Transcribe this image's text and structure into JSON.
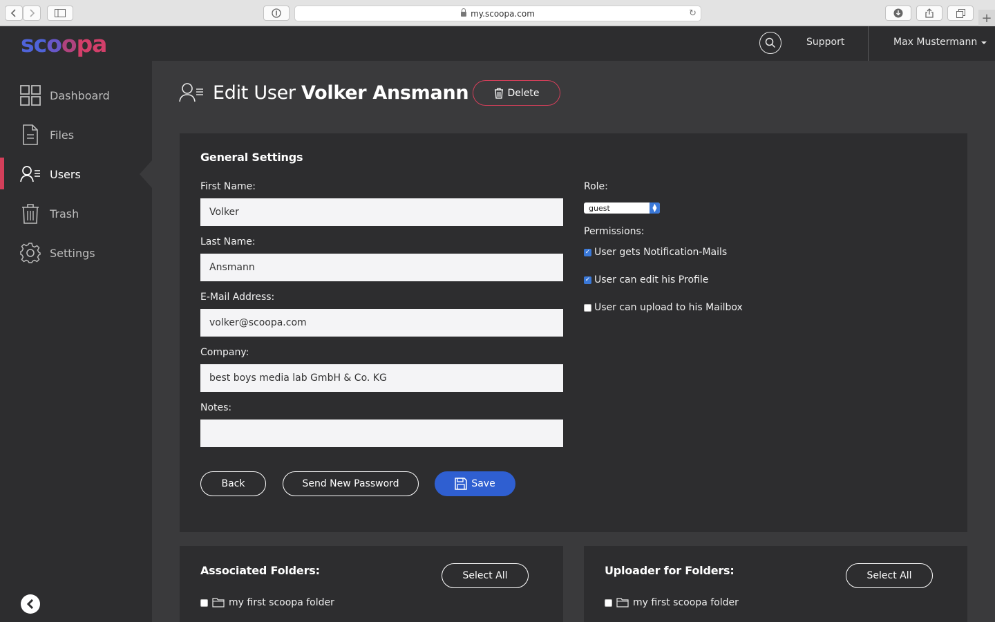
{
  "browser": {
    "url": "my.scoopa.com"
  },
  "brand": {
    "logo_text": "scoopa",
    "accent_red": "#d33f5a",
    "accent_blue": "#2f5fd1"
  },
  "topbar": {
    "support_label": "Support",
    "user_name": "Max Mustermann"
  },
  "sidebar": {
    "items": [
      {
        "label": "Dashboard",
        "icon": "dashboard-icon"
      },
      {
        "label": "Files",
        "icon": "file-icon"
      },
      {
        "label": "Users",
        "icon": "users-icon",
        "active": true
      },
      {
        "label": "Trash",
        "icon": "trash-icon"
      },
      {
        "label": "Settings",
        "icon": "gear-icon"
      }
    ]
  },
  "page": {
    "title_prefix": "Edit User",
    "title_name": "Volker Ansmann",
    "delete_label": "Delete"
  },
  "general": {
    "title": "General Settings",
    "first_name_label": "First Name:",
    "first_name": "Volker",
    "last_name_label": "Last Name:",
    "last_name": "Ansmann",
    "email_label": "E-Mail Address:",
    "email": "volker@scoopa.com",
    "company_label": "Company:",
    "company": "best boys media lab GmbH & Co. KG",
    "notes_label": "Notes:",
    "notes": "",
    "role_label": "Role:",
    "role_value": "guest",
    "permissions_label": "Permissions:",
    "permissions": [
      {
        "label": "User gets Notification-Mails",
        "checked": true
      },
      {
        "label": "User can edit his Profile",
        "checked": true
      },
      {
        "label": "User can upload to his Mailbox",
        "checked": false
      }
    ],
    "back_label": "Back",
    "send_password_label": "Send New Password",
    "save_label": "Save"
  },
  "associated": {
    "title": "Associated Folders:",
    "select_all_label": "Select All",
    "folder": "my first scoopa folder"
  },
  "uploader": {
    "title": "Uploader for Folders:",
    "select_all_label": "Select All",
    "folder": "my first scoopa folder"
  }
}
